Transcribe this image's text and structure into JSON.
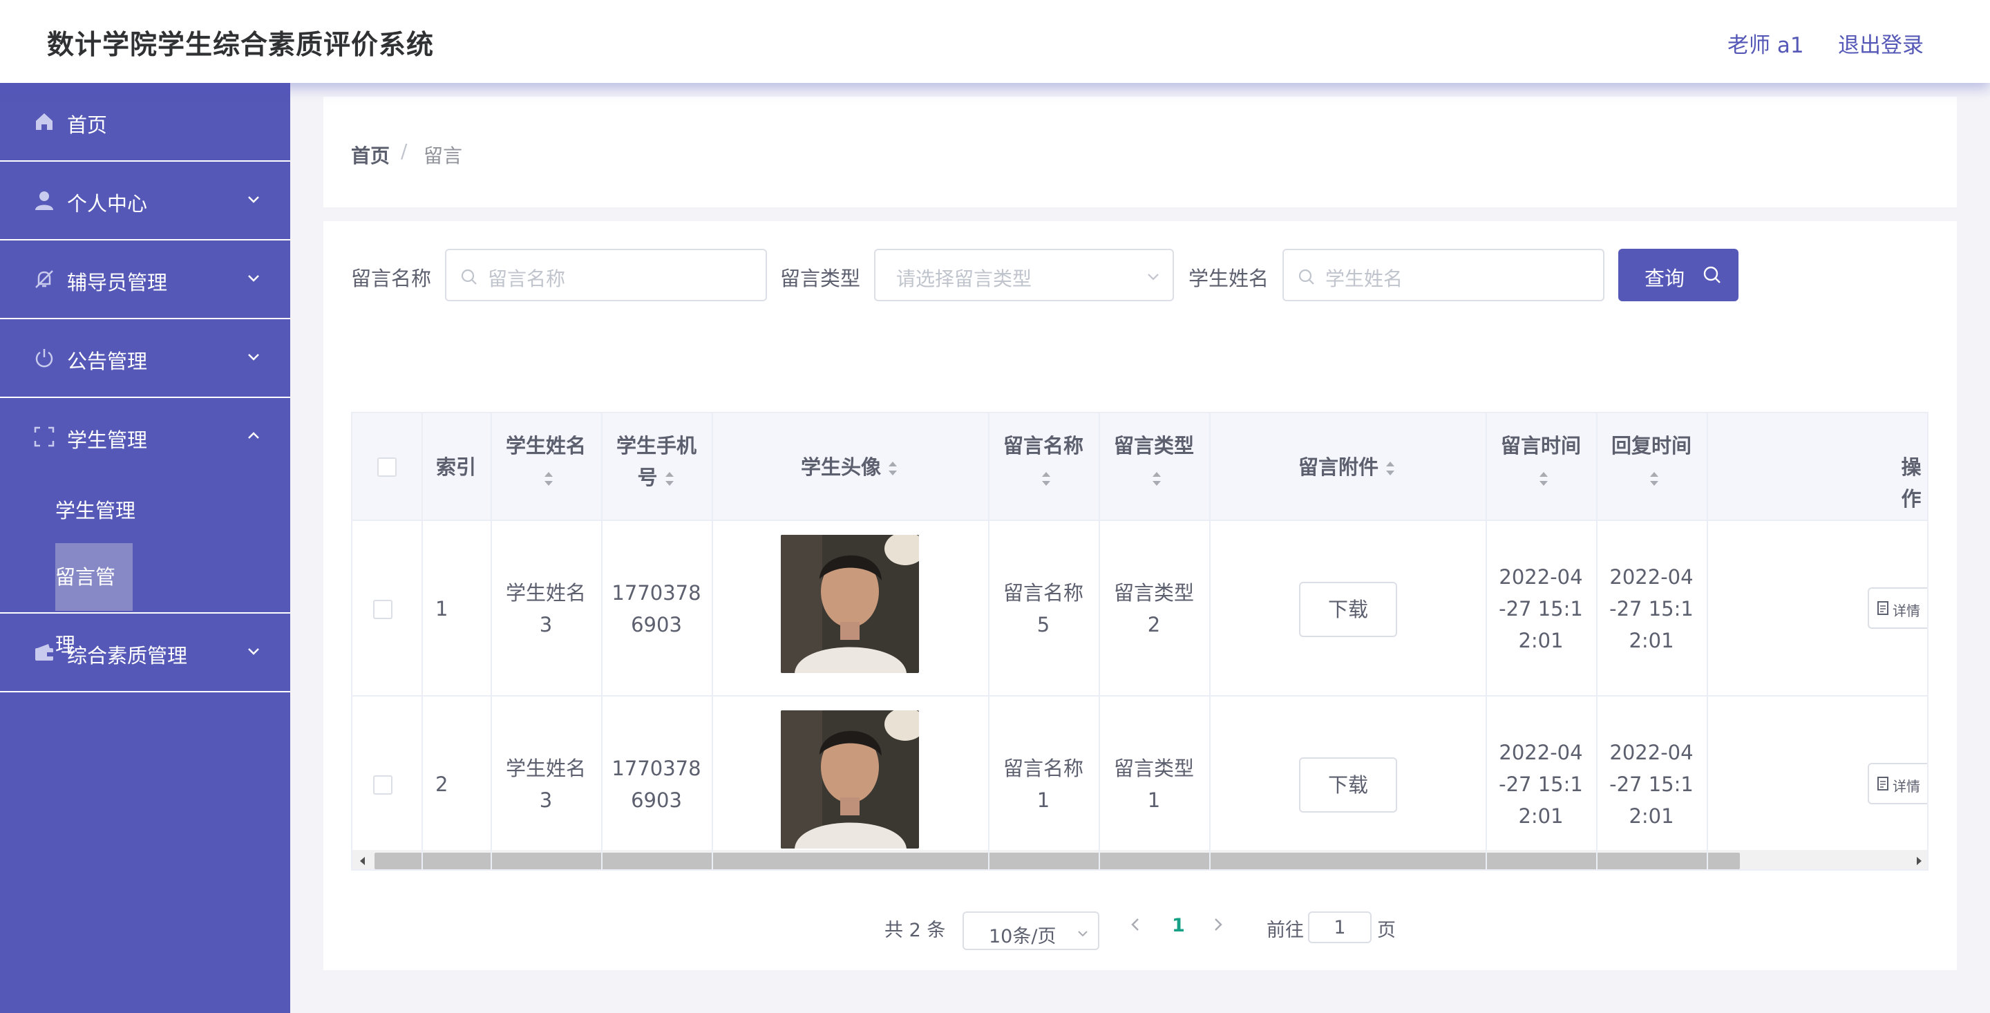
{
  "header": {
    "title": "数计学院学生综合素质评价系统",
    "user": "老师 a1",
    "logout": "退出登录"
  },
  "sidebar": {
    "items": [
      {
        "label": "首页",
        "icon": "home-icon"
      },
      {
        "label": "个人中心",
        "icon": "user-icon",
        "expanded": false
      },
      {
        "label": "辅导员管理",
        "icon": "bell-off-icon",
        "expanded": false
      },
      {
        "label": "公告管理",
        "icon": "power-icon",
        "expanded": false
      },
      {
        "label": "学生管理",
        "icon": "frame-icon",
        "expanded": true
      },
      {
        "label": "综合素质管理",
        "icon": "wallet-icon",
        "expanded": false
      }
    ],
    "subitems": [
      {
        "label": "学生管理",
        "active": false
      },
      {
        "label": "留言管理",
        "active": true
      }
    ]
  },
  "breadcrumb": {
    "home": "首页",
    "separator": "/",
    "current": "留言"
  },
  "filters": {
    "name_label": "留言名称",
    "name_placeholder": "留言名称",
    "type_label": "留言类型",
    "type_placeholder": "请选择留言类型",
    "student_label": "学生姓名",
    "student_placeholder": "学生姓名",
    "query_button": "查询"
  },
  "table": {
    "columns": {
      "index": "索引",
      "student_name": "学生姓名",
      "phone_1": "学生手机",
      "phone_2": "号",
      "avatar": "学生头像",
      "msg_name": "留言名称",
      "msg_type": "留言类型",
      "attachment": "留言附件",
      "msg_time": "留言时间",
      "reply_time": "回复时间",
      "actions": "操作"
    },
    "rows": [
      {
        "index": "1",
        "name_1": "学生姓名",
        "name_2": "3",
        "phone_1": "1770378",
        "phone_2": "6903",
        "msg_name_1": "留言名称",
        "msg_name_2": "5",
        "msg_type_1": "留言类型",
        "msg_type_2": "2",
        "download": "下载",
        "msg_time_1": "2022-04",
        "msg_time_2": "-27 15:1",
        "msg_time_3": "2:01",
        "reply_time_1": "2022-04",
        "reply_time_2": "-27 15:1",
        "reply_time_3": "2:01",
        "detail": "详情"
      },
      {
        "index": "2",
        "name_1": "学生姓名",
        "name_2": "3",
        "phone_1": "1770378",
        "phone_2": "6903",
        "msg_name_1": "留言名称",
        "msg_name_2": "1",
        "msg_type_1": "留言类型",
        "msg_type_2": "1",
        "download": "下载",
        "msg_time_1": "2022-04",
        "msg_time_2": "-27 15:1",
        "msg_time_3": "2:01",
        "reply_time_1": "2022-04",
        "reply_time_2": "-27 15:1",
        "reply_time_3": "2:01",
        "detail": "详情"
      }
    ]
  },
  "pagination": {
    "total": "共 2 条",
    "page_size": "10条/页",
    "current_page": "1",
    "goto_label": "前往",
    "goto_value": "1",
    "page_suffix": "页"
  },
  "colors": {
    "primary": "#5558b7",
    "sidebar_bg": "#5558b7",
    "active_submenu": "#8689c5",
    "current_page": "#16a085"
  }
}
